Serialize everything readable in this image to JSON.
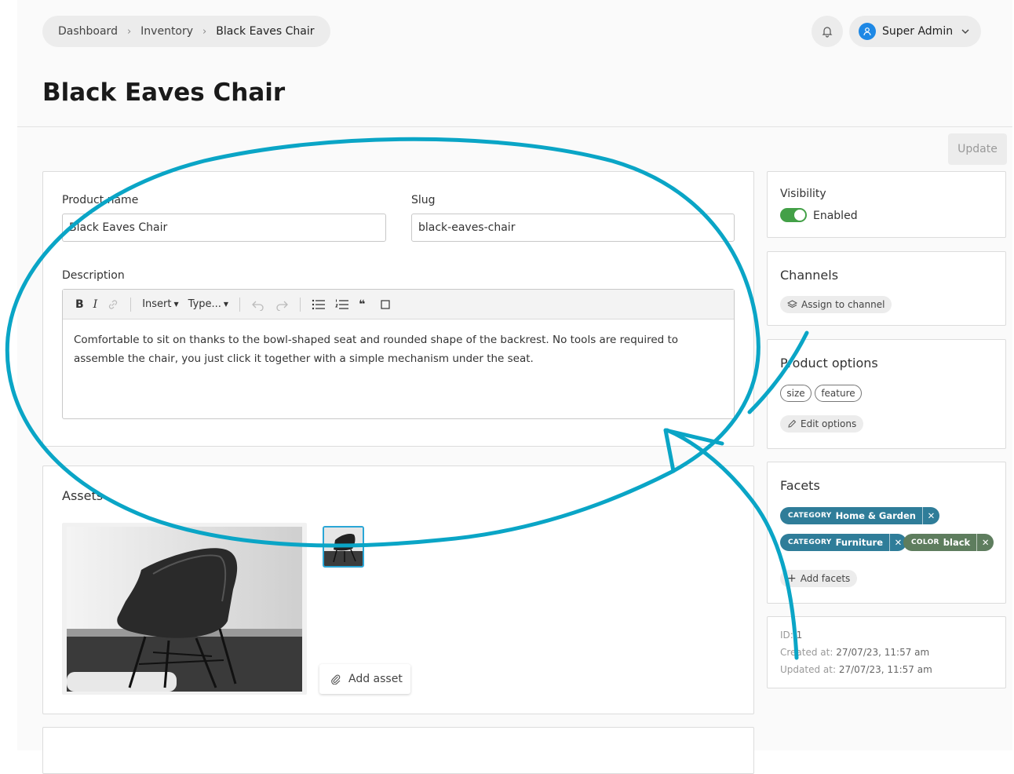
{
  "breadcrumb": {
    "items": [
      "Dashboard",
      "Inventory",
      "Black Eaves Chair"
    ]
  },
  "header": {
    "user_name": "Super Admin",
    "title": "Black Eaves Chair"
  },
  "actions": {
    "update_label": "Update"
  },
  "form": {
    "product_name_label": "Product name",
    "product_name_value": "Black Eaves Chair",
    "slug_label": "Slug",
    "slug_value": "black-eaves-chair",
    "description_label": "Description",
    "toolbar": {
      "bold": "B",
      "italic": "I",
      "insert": "Insert",
      "type": "Type...",
      "quote": "❝"
    },
    "description_text": "Comfortable to sit on thanks to the bowl-shaped seat and rounded shape of the backrest. No tools are required to assemble the chair, you just click it together with a simple mechanism under the seat."
  },
  "assets": {
    "title": "Assets",
    "add_label": "Add asset"
  },
  "sidebar": {
    "visibility": {
      "title": "Visibility",
      "state": "Enabled",
      "enabled": true
    },
    "channels": {
      "title": "Channels",
      "assign_label": "Assign to channel"
    },
    "product_options": {
      "title": "Product options",
      "options": [
        "size",
        "feature"
      ],
      "edit_label": "Edit options"
    },
    "facets": {
      "title": "Facets",
      "items": [
        {
          "key": "CATEGORY",
          "value": "Home & Garden",
          "color": "#2f7d99"
        },
        {
          "key": "CATEGORY",
          "value": "Furniture",
          "color": "#2f7d99"
        },
        {
          "key": "COLOR",
          "value": "black",
          "color": "#5e7d5e"
        }
      ],
      "add_label": "Add facets"
    },
    "meta": {
      "id_label": "ID:",
      "id_value": "1",
      "created_label": "Created at:",
      "created_value": "27/07/23, 11:57 am",
      "updated_label": "Updated at:",
      "updated_value": "27/07/23, 11:57 am"
    }
  },
  "colors": {
    "annotation": "#0aa5c6",
    "enabled": "#43a047"
  }
}
